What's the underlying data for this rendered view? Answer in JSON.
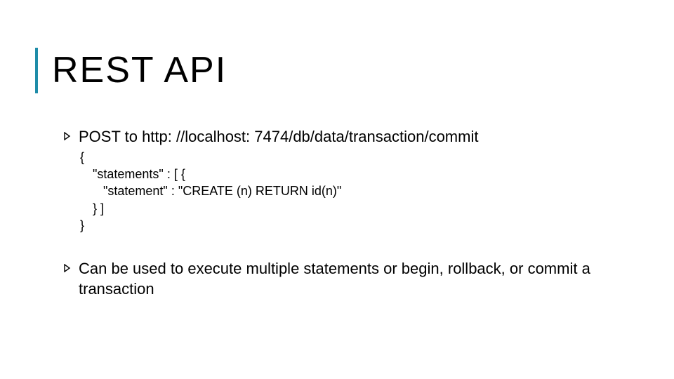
{
  "title": "REST API",
  "bullets": [
    {
      "text": "POST to http: //localhost: 7474/db/data/transaction/commit",
      "code": {
        "l0": "{",
        "l1": "\"statements\" : [ {",
        "l2": " \"statement\" : \"CREATE (n) RETURN id(n)\"",
        "l3": "} ]",
        "l4": "}"
      }
    },
    {
      "text": "Can be used to execute multiple statements or begin, rollback, or commit a transaction"
    }
  ]
}
